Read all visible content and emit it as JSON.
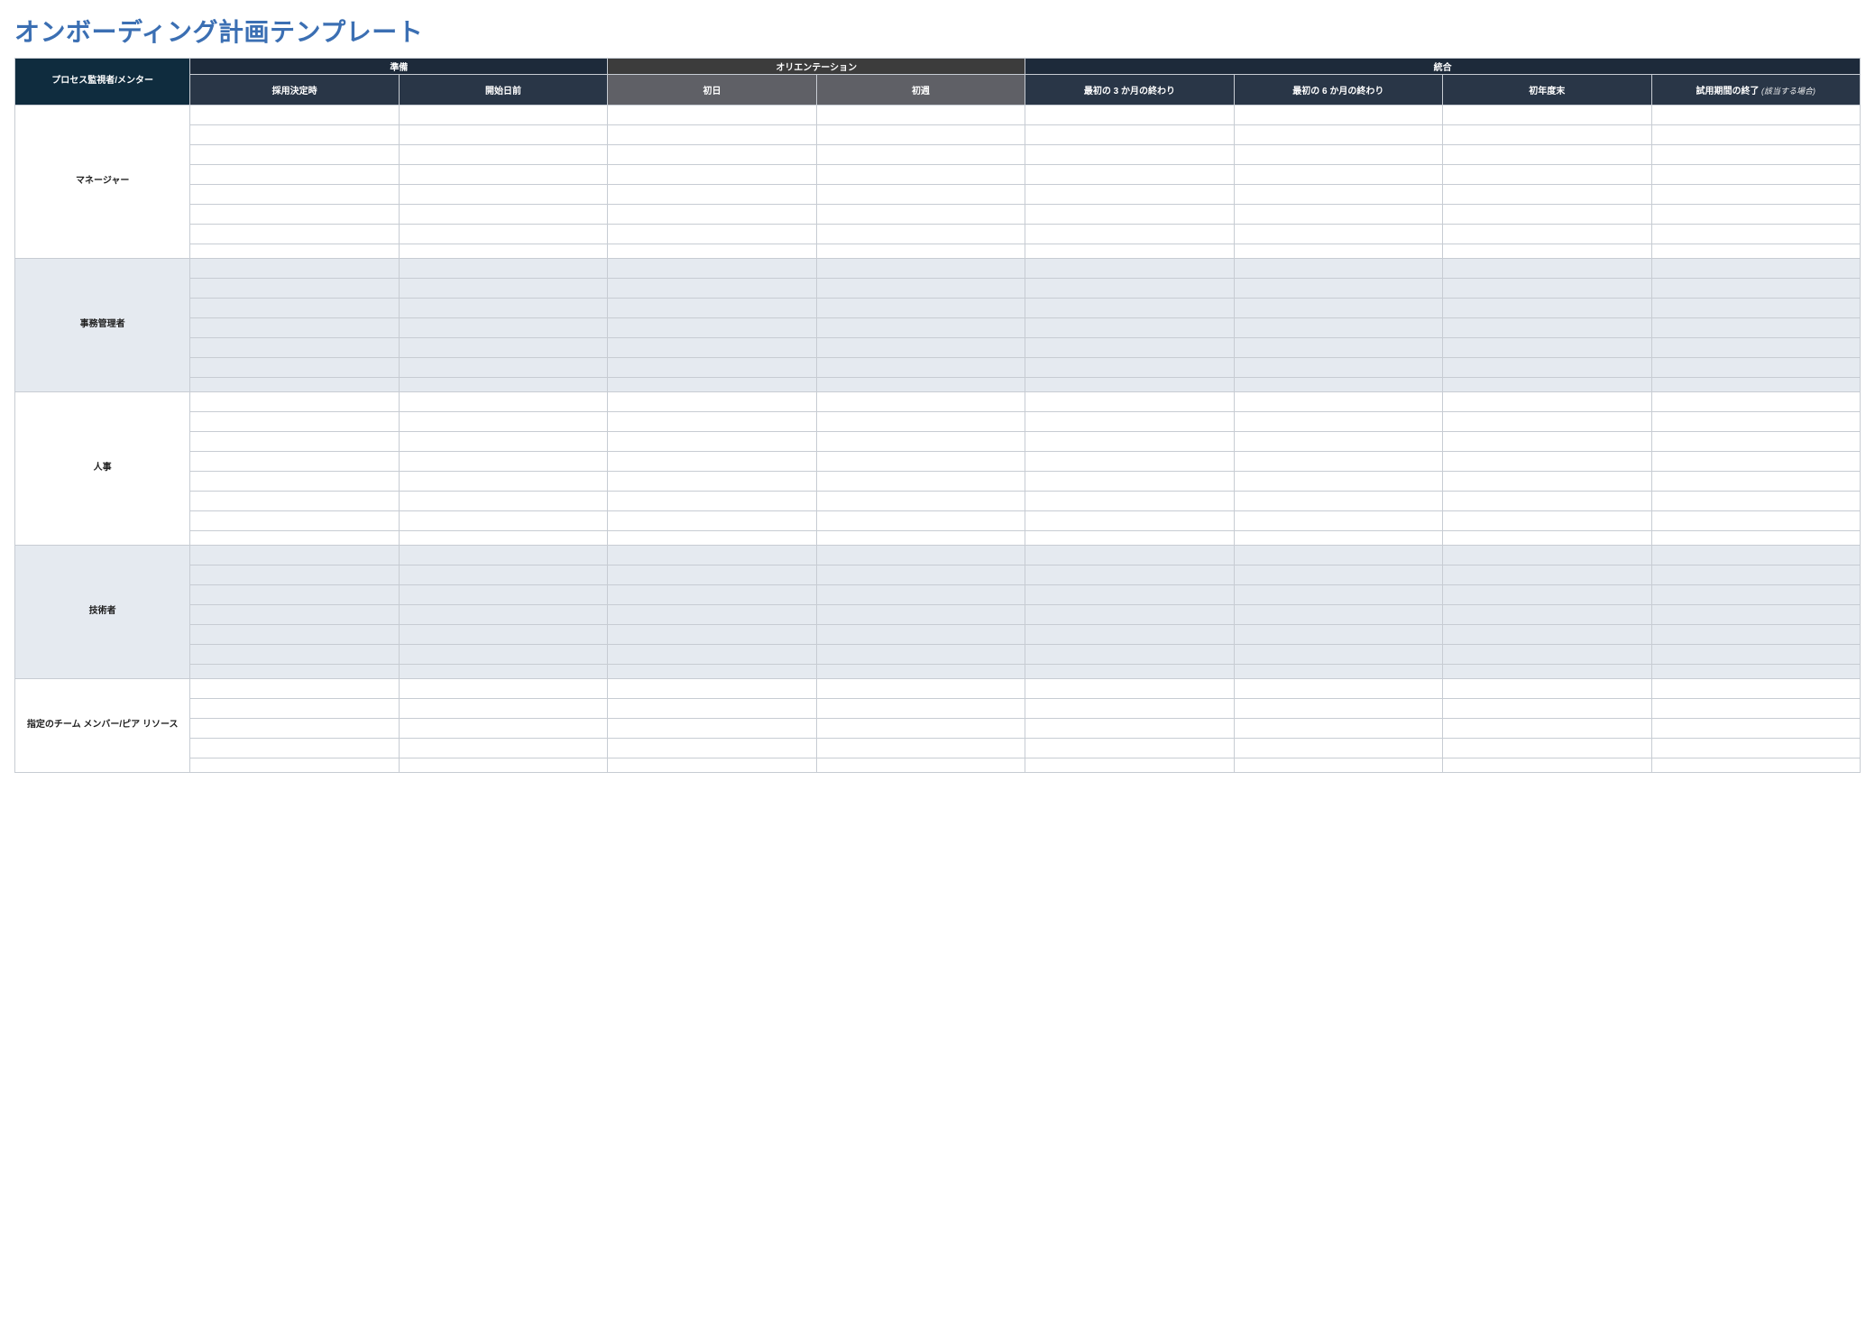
{
  "title": "オンボーディング計画テンプレート",
  "header": {
    "corner": "プロセス監視者/メンター",
    "phases": {
      "prep": "準備",
      "orient": "オリエンテーション",
      "integ": "統合"
    },
    "subcols": [
      "採用決定時",
      "開始日前",
      "初日",
      "初週",
      "最初の 3 か月の終わり",
      "最初の 6 か月の終わり",
      "初年度末",
      "試用期間の終了"
    ],
    "subcol_note_7": " (該当する場合)"
  },
  "sections": [
    {
      "label": "マネージャー",
      "rows": 8,
      "alt": false
    },
    {
      "label": "事務管理者",
      "rows": 7,
      "alt": true
    },
    {
      "label": "人事",
      "rows": 8,
      "alt": false
    },
    {
      "label": "技術者",
      "rows": 7,
      "alt": true
    },
    {
      "label": "指定のチーム メンバー/ピア リソース",
      "rows": 5,
      "alt": false
    }
  ]
}
